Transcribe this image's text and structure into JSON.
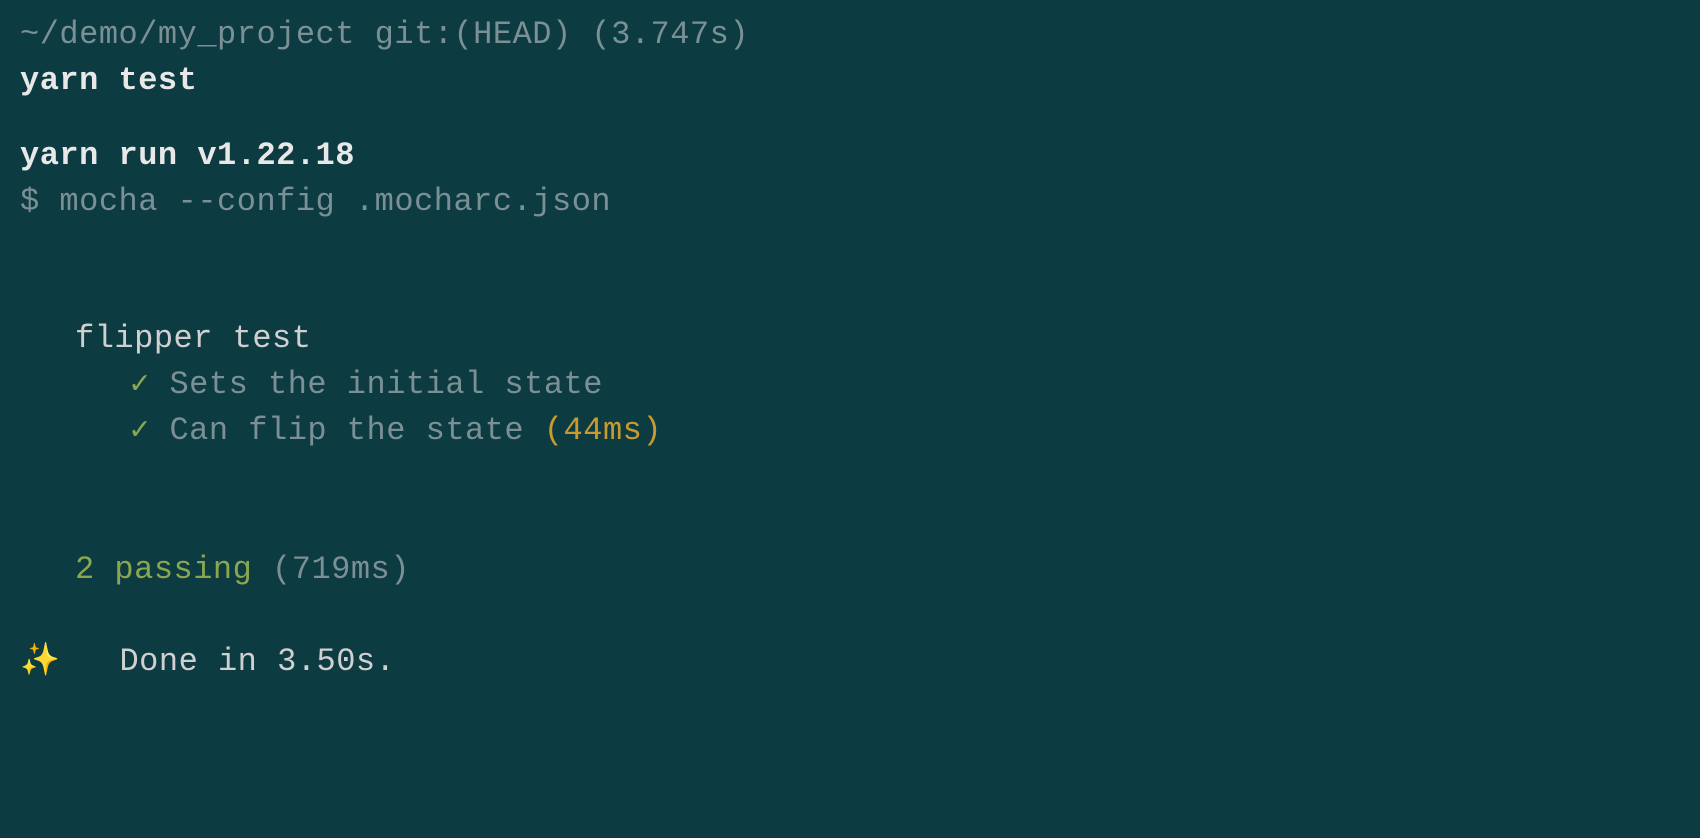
{
  "prompt": {
    "path": "~/demo/my_project",
    "git": "git:(HEAD)",
    "timing": "(3.747s)",
    "command": "yarn test"
  },
  "yarn": {
    "version_line": "yarn run v1.22.18",
    "dollar": "$",
    "mocha_cmd": "mocha --config .mocharc.json"
  },
  "suite": {
    "name": "flipper test",
    "tests": [
      {
        "check": "✓",
        "name": "Sets the initial state",
        "duration": ""
      },
      {
        "check": "✓",
        "name": "Can flip the state",
        "duration": "(44ms)"
      }
    ]
  },
  "summary": {
    "passing": "2 passing",
    "duration": "(719ms)"
  },
  "done": {
    "sparkles": "✨",
    "text": "Done in 3.50s."
  }
}
